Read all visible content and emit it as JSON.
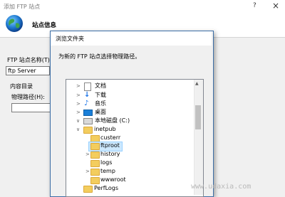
{
  "main_window": {
    "title": "添加 FTP 站点",
    "help": "?",
    "close": "×",
    "header_title": "站点信息",
    "site_name_label": "FTP 站点名称(T):",
    "site_name_value": "ftp Server",
    "content_dir_label": "内容目录",
    "physical_path_label": "物理路径(H):"
  },
  "browse_dialog": {
    "title": "浏览文件夹",
    "description": "为新的 FTP 站点选择物理路径。",
    "tree": {
      "documents": "文档",
      "downloads": "下载",
      "music": "音乐",
      "desktop": "桌面",
      "local_disk": "本地磁盘 (C:)",
      "inetpub": "inetpub",
      "custerr": "custerr",
      "ftproot": "ftproot",
      "history": "history",
      "logs": "logs",
      "temp": "temp",
      "wwwroot": "wwwroot",
      "perflogs": "PerfLogs"
    }
  },
  "watermark": "www.udaxia.com",
  "colors": {
    "selection_bg": "#cce8ff",
    "folder": "#f3cd5e",
    "accent": "#1a73e8"
  }
}
